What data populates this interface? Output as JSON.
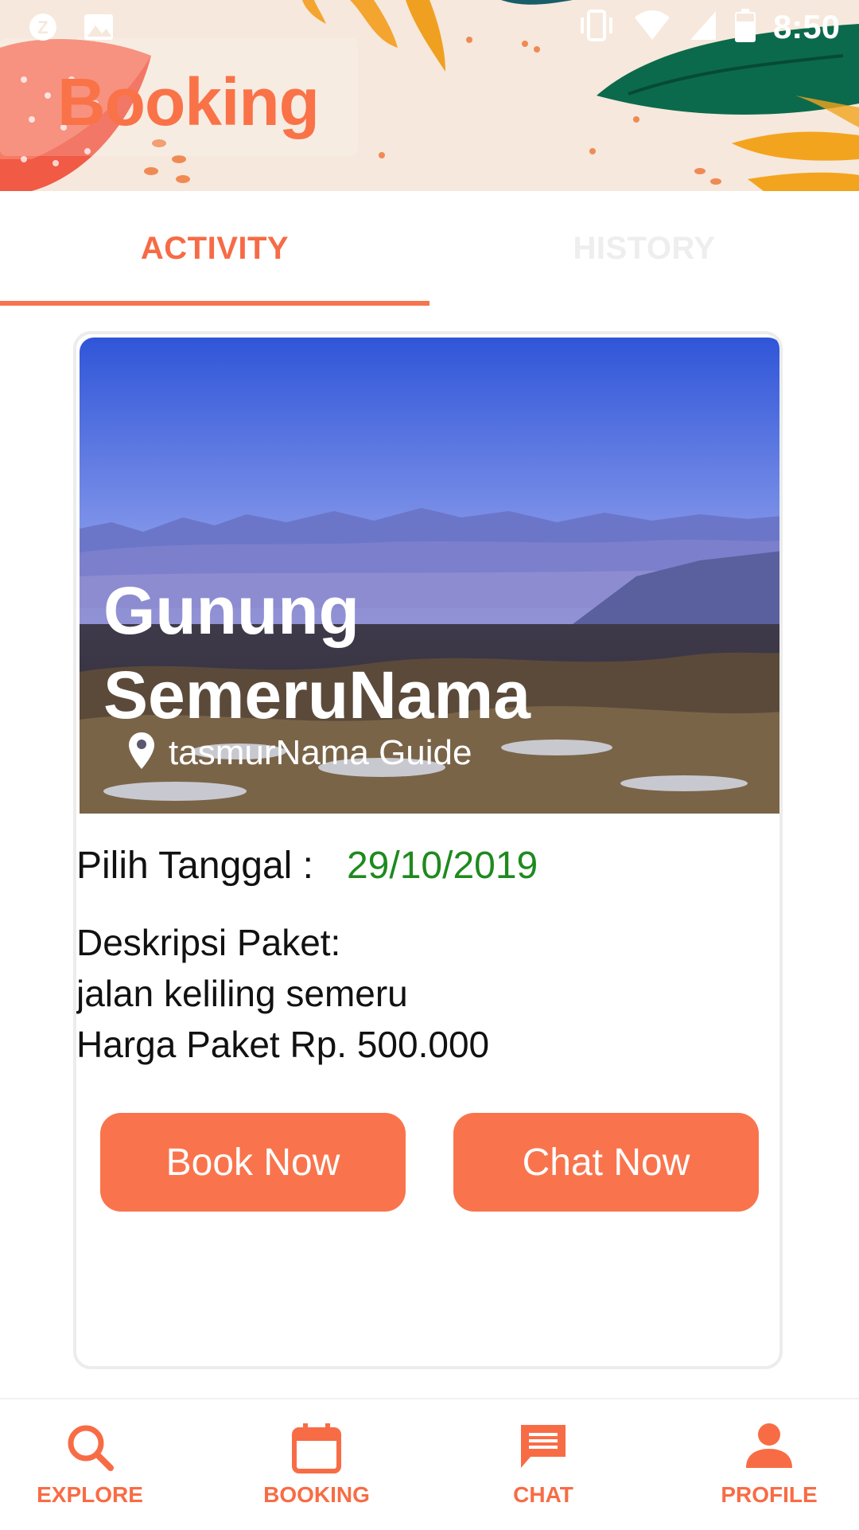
{
  "status_bar": {
    "time": "8:50"
  },
  "header": {
    "title": "Booking"
  },
  "tabs": [
    {
      "label": "ACTIVITY",
      "active": true
    },
    {
      "label": "HISTORY",
      "active": false
    }
  ],
  "card": {
    "title_line1": "Gunung",
    "title_line2": "SemeruNama",
    "guide": "tasmurNama Guide",
    "date_label": "Pilih Tanggal :",
    "date_value": "29/10/2019",
    "desc_label": "Deskripsi Paket:",
    "desc_text": "jalan keliling semeru",
    "price": "Harga Paket Rp. 500.000",
    "book_label": "Book Now",
    "chat_label": "Chat Now"
  },
  "bottom_nav": [
    {
      "label": "EXPLORE",
      "icon": "search-icon"
    },
    {
      "label": "BOOKING",
      "icon": "calendar-icon"
    },
    {
      "label": "CHAT",
      "icon": "chat-icon"
    },
    {
      "label": "PROFILE",
      "icon": "person-icon"
    }
  ],
  "colors": {
    "accent": "#f9744c",
    "date": "#1e8a1e",
    "tab_inactive": "#eeeeee"
  }
}
